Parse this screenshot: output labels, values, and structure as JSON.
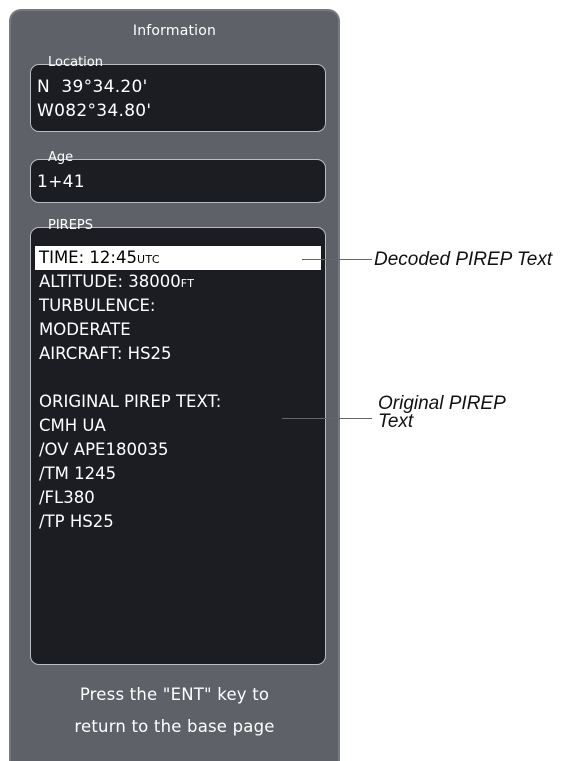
{
  "panel": {
    "title": "Information",
    "location": {
      "label": "Location",
      "lat": "N  39°34.20'",
      "lon": "W082°34.80'"
    },
    "age": {
      "label": "Age",
      "value": "1+41"
    },
    "pireps": {
      "label": "PIREPS",
      "lines": [
        {
          "text": "TIME: 12:45",
          "unit": "UTC",
          "highlighted": true
        },
        {
          "text": "ALTITUDE: 38000",
          "unit": "FT"
        },
        {
          "text": "TURBULENCE:"
        },
        {
          "text": "MODERATE"
        },
        {
          "text": "AIRCRAFT: HS25"
        },
        {
          "text": ""
        },
        {
          "text": "ORIGINAL PIREP TEXT:"
        },
        {
          "text": "CMH UA"
        },
        {
          "text": "/OV APE180035"
        },
        {
          "text": "/TM 1245"
        },
        {
          "text": "/FL380"
        },
        {
          "text": "/TP HS25"
        }
      ]
    },
    "footer": {
      "line1": "Press the \"ENT\" key to",
      "line2": "return to the base page"
    }
  },
  "callouts": {
    "decoded": "Decoded PIREP Text",
    "original_line1": "Original PIREP",
    "original_line2": "Text"
  },
  "colors": {
    "panel_bg": "#5e6167",
    "box_bg": "#1b1d22",
    "highlight_bg": "#ffffff"
  }
}
